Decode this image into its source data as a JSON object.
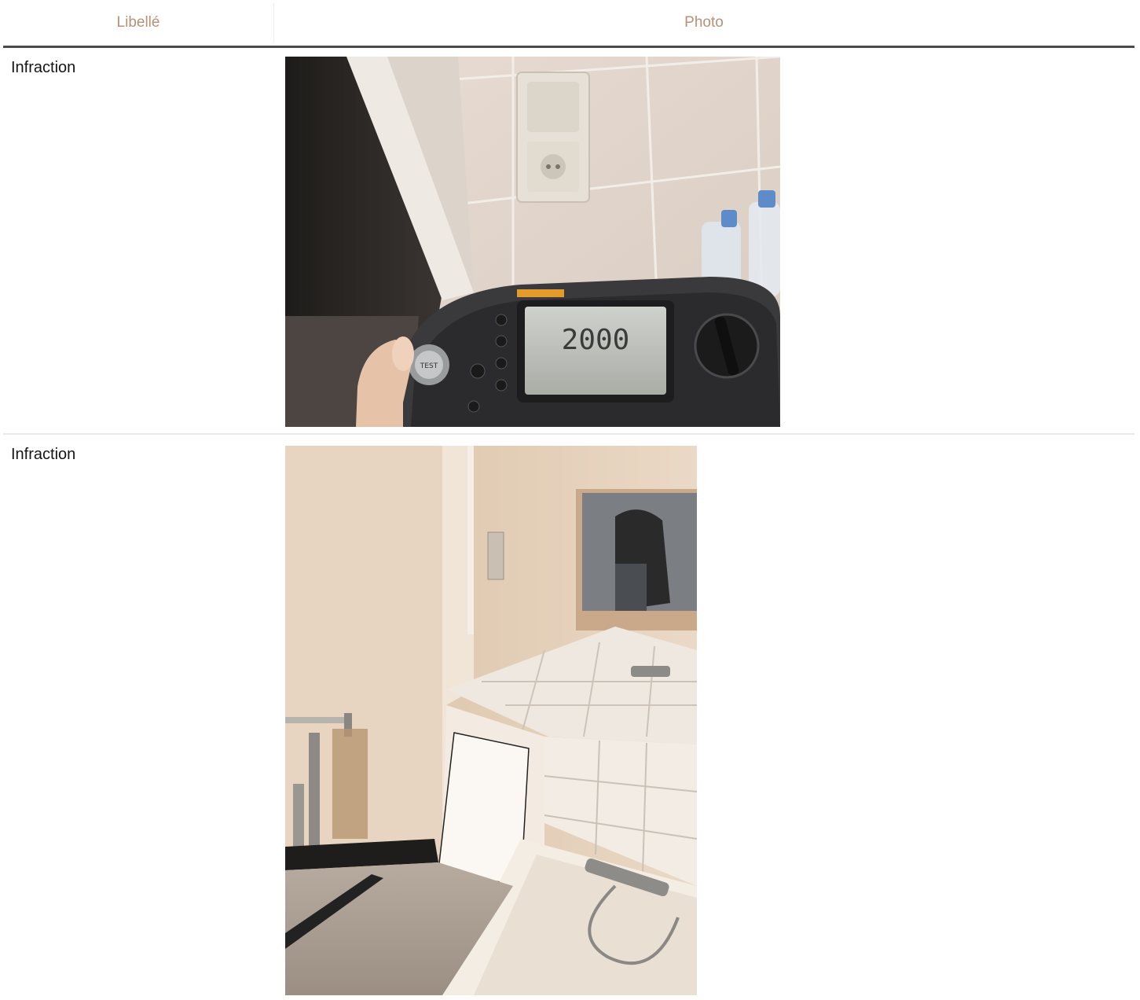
{
  "table": {
    "headers": {
      "label": "Libellé",
      "photo": "Photo"
    },
    "rows": [
      {
        "label": "Infraction",
        "photo_desc": "multimeter-reading"
      },
      {
        "label": "Infraction",
        "photo_desc": "bathroom"
      }
    ]
  },
  "meter": {
    "display": "2000",
    "button_text": "TEST"
  },
  "colors": {
    "header_text": "#b89078",
    "rule": "#4a4a4a"
  }
}
